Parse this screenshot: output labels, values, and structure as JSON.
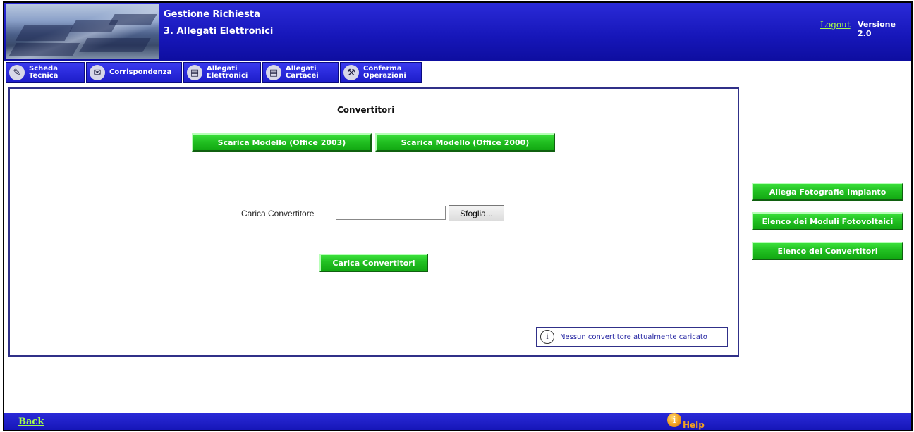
{
  "header": {
    "title": "Gestione Richiesta",
    "subtitle": "3. Allegati Elettronici",
    "logout": "Logout",
    "version": "Versione 2.0"
  },
  "nav": {
    "tabs": [
      {
        "line1": "Scheda",
        "line2": "Tecnica",
        "icon": "pencil-icon"
      },
      {
        "line1": "Corrispondenza",
        "line2": "",
        "icon": "envelope-icon"
      },
      {
        "line1": "Allegati",
        "line2": "Elettronici",
        "icon": "document-icon"
      },
      {
        "line1": "Allegati",
        "line2": "Cartacei",
        "icon": "document-icon"
      },
      {
        "line1": "Conferma",
        "line2": "Operazioni",
        "icon": "tools-icon"
      }
    ]
  },
  "main": {
    "section_title": "Convertitori",
    "download_2003": "Scarica Modello (Office 2003)",
    "download_2000": "Scarica Modello (Office 2000)",
    "upload_label": "Carica Convertitore",
    "upload_value": "",
    "browse_label": "Sfoglia...",
    "upload_button": "Carica Convertitori",
    "info_message": "Nessun convertitore attualmente caricato"
  },
  "side": {
    "photos": "Allega Fotografie Impianto",
    "modules": "Elenco dei Moduli Fotovoltaici",
    "converters": "Elenco dei Convertitori"
  },
  "footer": {
    "back": "Back",
    "help": "Help"
  },
  "colors": {
    "header_blue": "#1616b8",
    "button_green": "#22c022",
    "link_green": "#a6ff4a",
    "help_orange": "#f0a020"
  }
}
